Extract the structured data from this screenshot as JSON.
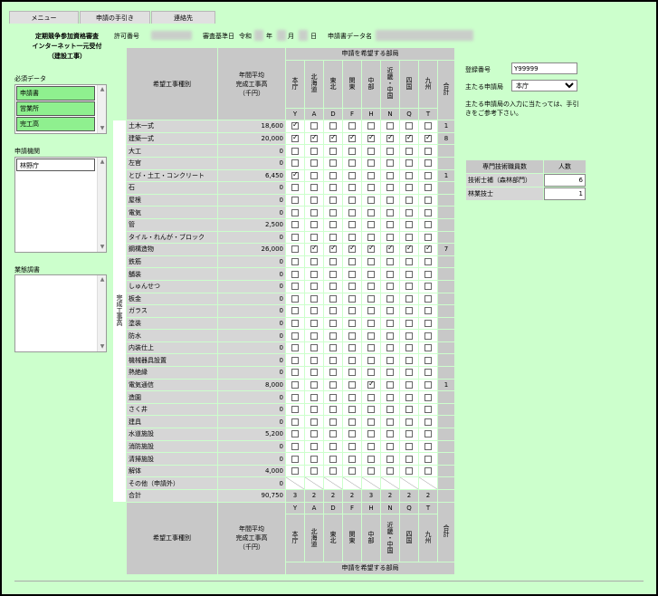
{
  "tabs": [
    "メニュー",
    "申請の手引き",
    "連絡先"
  ],
  "header": {
    "title_lines": [
      "定期競争参加資格審査",
      "インターネット一元受付",
      "（建設工事）"
    ],
    "permit_label": "許可番号",
    "base_date_label": "審査基準日",
    "era": "令和",
    "year_label": "年",
    "month_label": "月",
    "day_label": "日",
    "data_name_label": "申請書データ名"
  },
  "left": {
    "required_title": "必須データ",
    "required_items": [
      "申請書",
      "営業所",
      "完工高"
    ],
    "agency_title": "申請機関",
    "agency_items": [
      "林野庁"
    ],
    "business_title": "業態調書"
  },
  "table": {
    "top_header": "申請を希望する部局",
    "col_type": "希望工事種別",
    "col_avg": [
      "年間平均",
      "完成工事高",
      "（千円）"
    ],
    "regions": [
      "本庁",
      "北海道",
      "東北",
      "関東",
      "中部",
      "近畿・中国",
      "四国",
      "九州"
    ],
    "region_codes": [
      "Y",
      "A",
      "D",
      "F",
      "H",
      "N",
      "Q",
      "T"
    ],
    "total_label": "合計",
    "side_label": "完成工事高",
    "rows": [
      {
        "name": "土木一式",
        "amount": "18,600",
        "checks": [
          1,
          0,
          0,
          0,
          0,
          0,
          0,
          0
        ],
        "total": "1"
      },
      {
        "name": "建築一式",
        "amount": "20,000",
        "checks": [
          1,
          1,
          1,
          1,
          1,
          1,
          1,
          1
        ],
        "total": "8"
      },
      {
        "name": "大工",
        "amount": "0",
        "checks": [
          0,
          0,
          0,
          0,
          0,
          0,
          0,
          0
        ],
        "total": ""
      },
      {
        "name": "左官",
        "amount": "0",
        "checks": [
          0,
          0,
          0,
          0,
          0,
          0,
          0,
          0
        ],
        "total": ""
      },
      {
        "name": "とび・土工・コンクリート",
        "amount": "6,450",
        "checks": [
          1,
          0,
          0,
          0,
          0,
          0,
          0,
          0
        ],
        "total": "1"
      },
      {
        "name": "石",
        "amount": "0",
        "checks": [
          0,
          0,
          0,
          0,
          0,
          0,
          0,
          0
        ],
        "total": ""
      },
      {
        "name": "屋根",
        "amount": "0",
        "checks": [
          0,
          0,
          0,
          0,
          0,
          0,
          0,
          0
        ],
        "total": ""
      },
      {
        "name": "電気",
        "amount": "0",
        "checks": [
          0,
          0,
          0,
          0,
          0,
          0,
          0,
          0
        ],
        "total": ""
      },
      {
        "name": "管",
        "amount": "2,500",
        "checks": [
          0,
          0,
          0,
          0,
          0,
          0,
          0,
          0
        ],
        "total": ""
      },
      {
        "name": "タイル・れんが・ブロック",
        "amount": "0",
        "checks": [
          0,
          0,
          0,
          0,
          0,
          0,
          0,
          0
        ],
        "total": ""
      },
      {
        "name": "鋼構造物",
        "amount": "26,000",
        "checks": [
          0,
          1,
          1,
          1,
          1,
          1,
          1,
          1
        ],
        "total": "7"
      },
      {
        "name": "鉄筋",
        "amount": "0",
        "checks": [
          0,
          0,
          0,
          0,
          0,
          0,
          0,
          0
        ],
        "total": ""
      },
      {
        "name": "舗装",
        "amount": "0",
        "checks": [
          0,
          0,
          0,
          0,
          0,
          0,
          0,
          0
        ],
        "total": ""
      },
      {
        "name": "しゅんせつ",
        "amount": "0",
        "checks": [
          0,
          0,
          0,
          0,
          0,
          0,
          0,
          0
        ],
        "total": ""
      },
      {
        "name": "板金",
        "amount": "0",
        "checks": [
          0,
          0,
          0,
          0,
          0,
          0,
          0,
          0
        ],
        "total": ""
      },
      {
        "name": "ガラス",
        "amount": "0",
        "checks": [
          0,
          0,
          0,
          0,
          0,
          0,
          0,
          0
        ],
        "total": ""
      },
      {
        "name": "塗装",
        "amount": "0",
        "checks": [
          0,
          0,
          0,
          0,
          0,
          0,
          0,
          0
        ],
        "total": ""
      },
      {
        "name": "防水",
        "amount": "0",
        "checks": [
          0,
          0,
          0,
          0,
          0,
          0,
          0,
          0
        ],
        "total": ""
      },
      {
        "name": "内装仕上",
        "amount": "0",
        "checks": [
          0,
          0,
          0,
          0,
          0,
          0,
          0,
          0
        ],
        "total": ""
      },
      {
        "name": "機械器具設置",
        "amount": "0",
        "checks": [
          0,
          0,
          0,
          0,
          0,
          0,
          0,
          0
        ],
        "total": ""
      },
      {
        "name": "熱絶縁",
        "amount": "0",
        "checks": [
          0,
          0,
          0,
          0,
          0,
          0,
          0,
          0
        ],
        "total": ""
      },
      {
        "name": "電気通信",
        "amount": "8,000",
        "checks": [
          0,
          0,
          0,
          0,
          1,
          0,
          0,
          0
        ],
        "total": "1"
      },
      {
        "name": "造園",
        "amount": "0",
        "checks": [
          0,
          0,
          0,
          0,
          0,
          0,
          0,
          0
        ],
        "total": ""
      },
      {
        "name": "さく井",
        "amount": "0",
        "checks": [
          0,
          0,
          0,
          0,
          0,
          0,
          0,
          0
        ],
        "total": ""
      },
      {
        "name": "建具",
        "amount": "0",
        "checks": [
          0,
          0,
          0,
          0,
          0,
          0,
          0,
          0
        ],
        "total": ""
      },
      {
        "name": "水道施設",
        "amount": "5,200",
        "checks": [
          0,
          0,
          0,
          0,
          0,
          0,
          0,
          0
        ],
        "total": ""
      },
      {
        "name": "消防施設",
        "amount": "0",
        "checks": [
          0,
          0,
          0,
          0,
          0,
          0,
          0,
          0
        ],
        "total": ""
      },
      {
        "name": "清掃施設",
        "amount": "0",
        "checks": [
          0,
          0,
          0,
          0,
          0,
          0,
          0,
          0
        ],
        "total": ""
      },
      {
        "name": "解体",
        "amount": "4,000",
        "checks": [
          0,
          0,
          0,
          0,
          0,
          0,
          0,
          0
        ],
        "total": ""
      }
    ],
    "other_row": {
      "name": "その他（申請外）",
      "amount": "0"
    },
    "sum_row": {
      "name": "合計",
      "amount": "90,750",
      "counts": [
        "3",
        "2",
        "2",
        "2",
        "3",
        "2",
        "2",
        "2"
      ]
    }
  },
  "right": {
    "reg_label": "登録番号",
    "reg_value": "Y99999",
    "main_label": "主たる申請局",
    "main_value": "本庁",
    "note": "主たる申請局の入力に当たっては、手引きをご参考下さい。",
    "eng_header": "専門技術職員数",
    "eng_count_header": "人数",
    "engineers": [
      {
        "label": "技術士補（森林部門）",
        "value": "6"
      },
      {
        "label": "林業技士",
        "value": "1"
      }
    ]
  }
}
